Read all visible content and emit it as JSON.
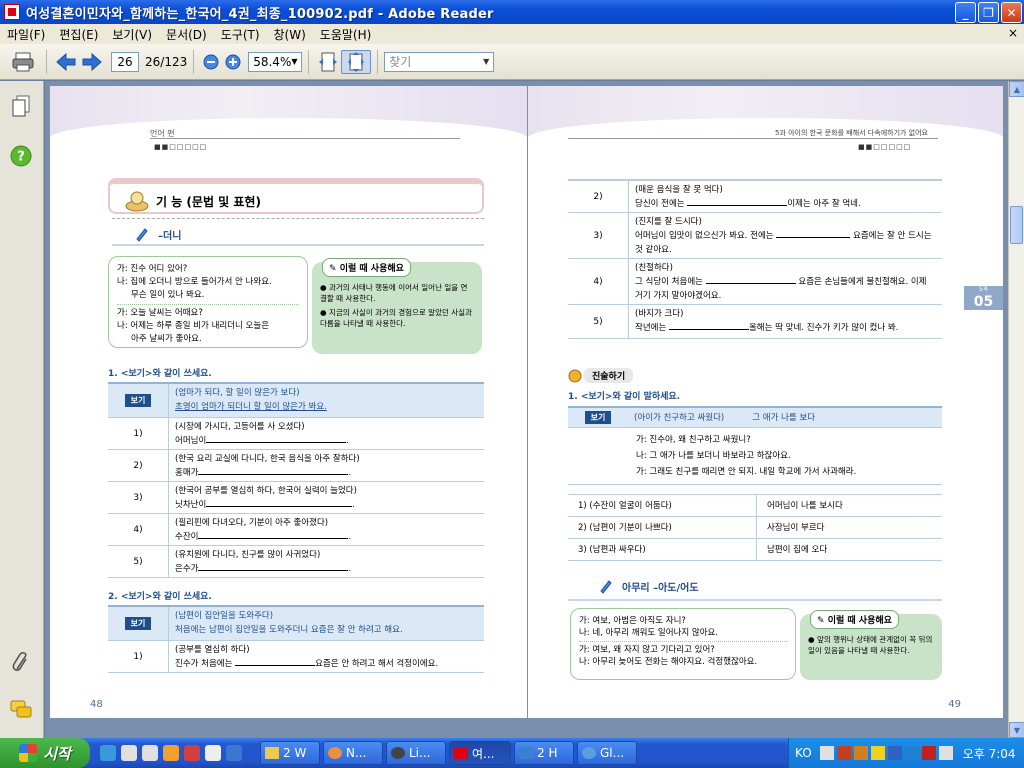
{
  "window": {
    "title": "여성결혼이민자와_함께하는_한국어_4권_최종_100902.pdf - Adobe Reader"
  },
  "menu": {
    "items": [
      "파일(F)",
      "편집(E)",
      "보기(V)",
      "문서(D)",
      "도구(T)",
      "창(W)",
      "도움말(H)"
    ],
    "close_label": "×"
  },
  "toolbar": {
    "page_current": "26",
    "page_total": "26/123",
    "zoom": "58.4%",
    "search_placeholder": "찾기"
  },
  "left_page": {
    "header_tab": "언어 편",
    "header_dots": "■■□□□□□",
    "section_title": "기 능 (문법 및 표현)",
    "grammar_title": "–더니",
    "dialog": [
      "가: 진수 어디 있어?",
      "나: 집에 오더니 방으로 들어가서 안 나와요.",
      "무슨 일이 있나 봐요.",
      "가: 오늘 날씨는 어때요?",
      "나: 어제는 하루 종일 비가 내리더니 오늘은",
      "아주 날씨가 좋아요."
    ],
    "usage_tag": "이럴 때 사용해요",
    "usage_notes": [
      "과거의 사태나 행동에 이어서 일어난 일을 연결할 때 사용한다.",
      "지금의 사실이 과거의 경험으로 알았던 사실과 다름을 나타낼 때 사용한다."
    ],
    "q1_title": "1. <보기>와 같이 쓰세요.",
    "q1_example_label": "보기",
    "q1_example": [
      "(엄마가 되다, 할 일이 많은가 보다)",
      "초영이 엄마가 되더니 할 일이 많은가 봐요."
    ],
    "q1_rows": [
      {
        "num": "1)",
        "prompt": "(시장에 가시다, 고등어를 사 오셨다)",
        "answer": "어머님이"
      },
      {
        "num": "2)",
        "prompt": "(한국 요리 교실에 다니다, 한국 음식을 아주 잘하다)",
        "answer": "홍매가"
      },
      {
        "num": "3)",
        "prompt": "(한국어 공부를 열심히 하다, 한국어 실력이 늘었다)",
        "answer": "닛차난이"
      },
      {
        "num": "4)",
        "prompt": "(필리핀에 다녀오다, 기분이 아주 좋아졌다)",
        "answer": "수잔이"
      },
      {
        "num": "5)",
        "prompt": "(유치원에 다니다, 친구를 많이 사귀었다)",
        "answer": "은수가"
      }
    ],
    "q2_title": "2. <보기>와 같이 쓰세요.",
    "q2_example_label": "보기",
    "q2_example": [
      "(남편이 집안일을 도와주다)",
      "처음에는 남편이 집안일을 도와주더니 요즘은 잘 안 하려고 해요."
    ],
    "q2_rows": [
      {
        "num": "1)",
        "prompt": "(공부를 열심히 하다)",
        "answer": "진수가 처음에는",
        "tail": "요즘은 안 하려고 해서 걱정이에요."
      }
    ],
    "page_number": "48"
  },
  "right_page": {
    "header_tab": "5과   아이의 한국 문화를 배해서 다속에하기가 없어요",
    "header_dots": "■■□□□□□",
    "rows": [
      {
        "num": "2)",
        "prompt": "(매운 음식을 잘 못 먹다)",
        "line": "당신이 전에는",
        "tail": "이제는 아주 잘 먹네."
      },
      {
        "num": "3)",
        "prompt": "(진지를 잘 드시다)",
        "line": "어머님이 입맛이 없으신가 봐요. 전에는",
        "tail": "요즘에는 잘 안 드시는 것 같아요."
      },
      {
        "num": "4)",
        "prompt": "(친절하다)",
        "line": "그 식당이 처음에는",
        "tail": "요즘은 손님들에게 불친절해요. 이제 거기 가지 말아야겠어요."
      },
      {
        "num": "5)",
        "prompt": "(바지가 크다)",
        "line": "작년에는",
        "tail": "올해는 딱 맞네. 진수가 키가 많이 컸나 봐."
      }
    ],
    "side_tab_label": "5과",
    "side_tab_number": "05",
    "speak_label": "진술하기",
    "q1_title": "1. <보기>와 같이 말하세요.",
    "q1_example_label": "보기",
    "q1_example_prompt": "(아이가 친구하고 싸웠다)",
    "q1_example_prompt2": "그 애가 나를 보다",
    "q1_example_lines": [
      "가: 진수야, 왜 친구하고 싸웠니?",
      "나: 그 애가 나를 보더니 바보라고 하잖아요.",
      "가: 그래도 친구를 때리면 안 되지. 내일 학교에 가서 사과해라."
    ],
    "q1_rows": [
      {
        "left": "1) (수잔이 얼굴이 어둡다)",
        "right": "어머님이 나를 보시다"
      },
      {
        "left": "2) (남편이 기분이 나쁘다)",
        "right": "사장님이 부르다"
      },
      {
        "left": "3) (남편과 싸우다)",
        "right": "남편이 집에 오다"
      }
    ],
    "grammar_title": "아무리 –아도/어도",
    "dialog": [
      "가: 여보, 아범은 아직도 자니?",
      "나: 네, 아무리 깨워도 일어나지 않아요.",
      "가: 여보, 왜 자지 않고 기다리고 있어?",
      "나: 아무리 늦어도 전화는 해야지요. 걱정했잖아요."
    ],
    "usage_tag": "이럴 때 사용해요",
    "usage_notes": [
      "앞의 행위나 상태에 관계없이 꼭 뒤의 일이 있음을 나타낼 때 사용한다."
    ],
    "page_number": "49"
  },
  "taskbar": {
    "start_label": "시작",
    "tasks": [
      {
        "label": "2 W",
        "active": false
      },
      {
        "label": "N...",
        "active": false
      },
      {
        "label": "Li...",
        "active": false
      },
      {
        "label": "여...",
        "active": true
      },
      {
        "label": "2 H",
        "active": false
      },
      {
        "label": "Gl...",
        "active": false
      }
    ],
    "lang": "KO",
    "clock": "오후 7:04"
  }
}
